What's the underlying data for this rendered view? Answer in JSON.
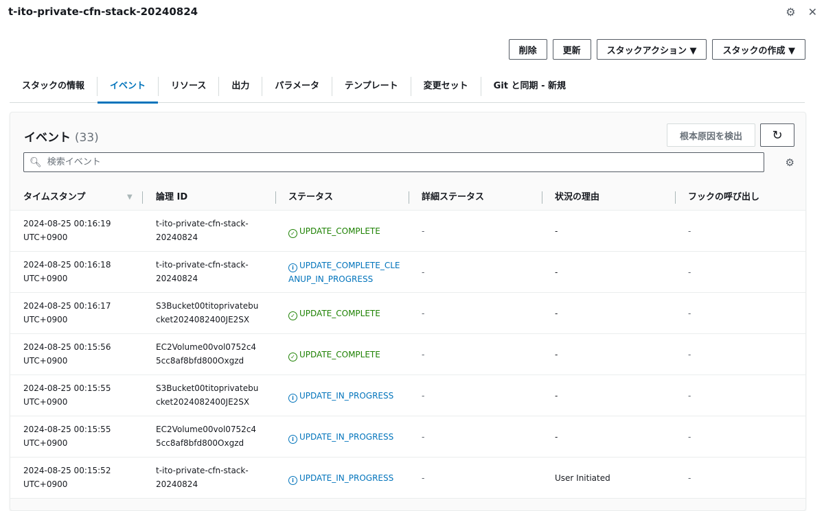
{
  "header": {
    "title": "t-ito-private-cfn-stack-20240824"
  },
  "actions": {
    "delete": "削除",
    "update": "更新",
    "stack_actions": "スタックアクション ▼",
    "create_stack": "スタックの作成 ▼"
  },
  "tabs": [
    "スタックの情報",
    "イベント",
    "リソース",
    "出力",
    "パラメータ",
    "テンプレート",
    "変更セット",
    "Git と同期 - 新規"
  ],
  "active_tab": "イベント",
  "events": {
    "title": "イベント",
    "count": "(33)",
    "detect_root_cause": "根本原因を検出",
    "search_placeholder": "検索イベント",
    "columns": [
      "タイムスタンプ",
      "論理 ID",
      "ステータス",
      "詳細ステータス",
      "状況の理由",
      "フックの呼び出し"
    ],
    "rows": [
      {
        "ts1": "2024-08-25 00:16:19",
        "ts2": "UTC+0900",
        "id1": "t-ito-private-cfn-stack-",
        "id2": "20240824",
        "status": "UPDATE_COMPLETE",
        "kind": "complete",
        "detail": "-",
        "reason": "-",
        "hook": "-"
      },
      {
        "ts1": "2024-08-25 00:16:18",
        "ts2": "UTC+0900",
        "id1": "t-ito-private-cfn-stack-",
        "id2": "20240824",
        "status": "UPDATE_COMPLETE_CLEANUP_IN_PROGRESS",
        "kind": "progress",
        "detail": "-",
        "reason": "-",
        "hook": "-"
      },
      {
        "ts1": "2024-08-25 00:16:17",
        "ts2": "UTC+0900",
        "id1": "S3Bucket00titoprivatebu",
        "id2": "cket2024082400JE2SX",
        "status": "UPDATE_COMPLETE",
        "kind": "complete",
        "detail": "-",
        "reason": "-",
        "hook": "-"
      },
      {
        "ts1": "2024-08-25 00:15:56",
        "ts2": "UTC+0900",
        "id1": "EC2Volume00vol0752c4",
        "id2": "5cc8af8bfd800Oxgzd",
        "status": "UPDATE_COMPLETE",
        "kind": "complete",
        "detail": "-",
        "reason": "-",
        "hook": "-"
      },
      {
        "ts1": "2024-08-25 00:15:55",
        "ts2": "UTC+0900",
        "id1": "S3Bucket00titoprivatebu",
        "id2": "cket2024082400JE2SX",
        "status": "UPDATE_IN_PROGRESS",
        "kind": "progress",
        "detail": "-",
        "reason": "-",
        "hook": "-"
      },
      {
        "ts1": "2024-08-25 00:15:55",
        "ts2": "UTC+0900",
        "id1": "EC2Volume00vol0752c4",
        "id2": "5cc8af8bfd800Oxgzd",
        "status": "UPDATE_IN_PROGRESS",
        "kind": "progress",
        "detail": "-",
        "reason": "-",
        "hook": "-"
      },
      {
        "ts1": "2024-08-25 00:15:52",
        "ts2": "UTC+0900",
        "id1": "t-ito-private-cfn-stack-",
        "id2": "20240824",
        "status": "UPDATE_IN_PROGRESS",
        "kind": "progress",
        "detail": "-",
        "reason": "User Initiated",
        "hook": "-"
      }
    ]
  },
  "colors": {
    "accent": "#0073bb",
    "success": "#1d8102",
    "border": "#d5dbdb"
  },
  "icons": {
    "settings": "gear-icon",
    "close": "close-icon",
    "search": "search-icon",
    "refresh": "refresh-icon",
    "sort": "sort-down-icon",
    "complete": "check-circle-icon",
    "progress": "info-circle-icon"
  }
}
